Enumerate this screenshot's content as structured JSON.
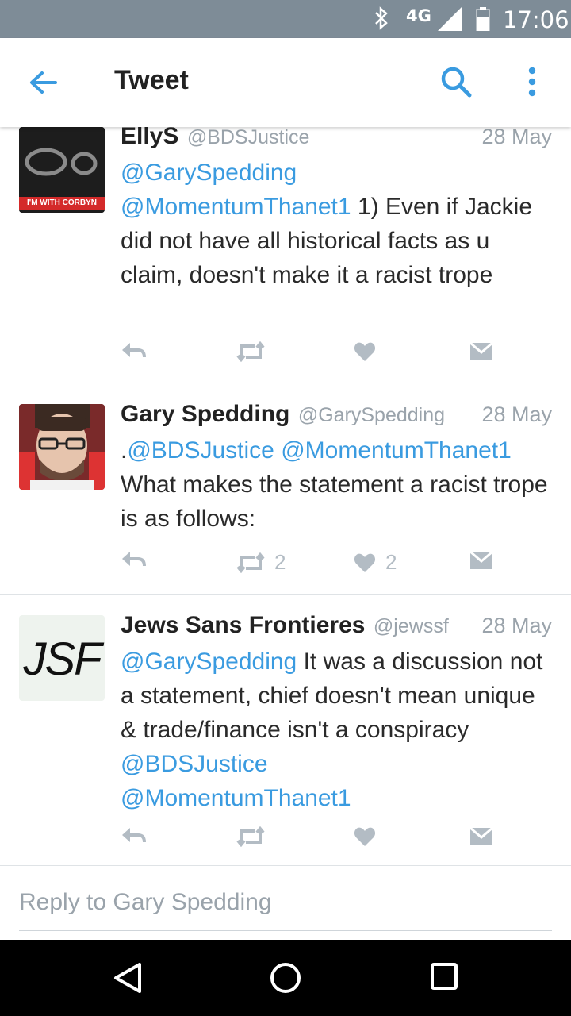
{
  "status_bar": {
    "network": "4G",
    "time": "17:06"
  },
  "app_bar": {
    "title": "Tweet"
  },
  "tweets": [
    {
      "name": "EllyS",
      "handle": "@BDSJustice",
      "date": "28 May",
      "avatar_caption": "I'M WITH CORBYN",
      "body_mentions": "@GarySpedding",
      "body_mention2": "@MomentumThanet1",
      "body_text": " 1) Even if Jackie did not have all historical facts as u claim, doesn't make it a racist trope",
      "retweets": "",
      "likes": ""
    },
    {
      "name": "Gary Spedding",
      "handle": "@GarySpedding",
      "date": "28 May",
      "body_prefix": ".",
      "body_mention1": "@BDSJustice",
      "body_mention2": "@MomentumThanet1",
      "body_text": "What makes the statement a racist trope is as follows:",
      "retweets": "2",
      "likes": "2"
    },
    {
      "name": "Jews Sans Frontieres",
      "handle": "@jewssf",
      "date": "28 May",
      "avatar_text": "JSF",
      "body_mention1": "@GarySpedding",
      "body_text": " It was a discussion not a statement, chief doesn't mean unique & trade/finance isn't a conspiracy ",
      "body_mention2": "@BDSJustice",
      "body_mention3": "@MomentumThanet1",
      "retweets": "",
      "likes": ""
    }
  ],
  "reply_box": {
    "placeholder": "Reply to Gary Spedding"
  },
  "colors": {
    "accent": "#3a9be0",
    "status_bar": "#7e8c97",
    "icon_gray": "#b3bcc4"
  }
}
